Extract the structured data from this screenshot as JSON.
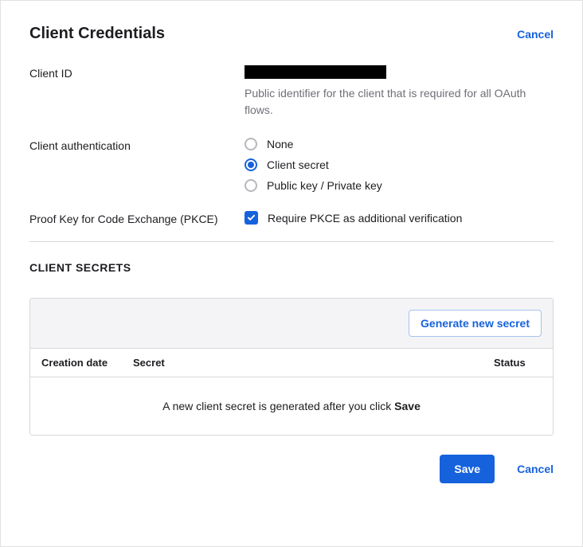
{
  "header": {
    "title": "Client Credentials",
    "cancel": "Cancel"
  },
  "clientId": {
    "label": "Client ID",
    "help": "Public identifier for the client that is required for all OAuth flows."
  },
  "auth": {
    "label": "Client authentication",
    "options": {
      "none": "None",
      "secret": "Client secret",
      "pkpk": "Public key / Private key"
    },
    "selected": "secret"
  },
  "pkce": {
    "label": "Proof Key for Code Exchange (PKCE)",
    "option": "Require PKCE as additional verification",
    "checked": true
  },
  "secrets": {
    "heading": "CLIENT SECRETS",
    "generate": "Generate new secret",
    "columns": {
      "date": "Creation date",
      "secret": "Secret",
      "status": "Status"
    },
    "emptyPrefix": "A new client secret is generated after you click ",
    "emptySaveWord": "Save"
  },
  "footer": {
    "save": "Save",
    "cancel": "Cancel"
  }
}
